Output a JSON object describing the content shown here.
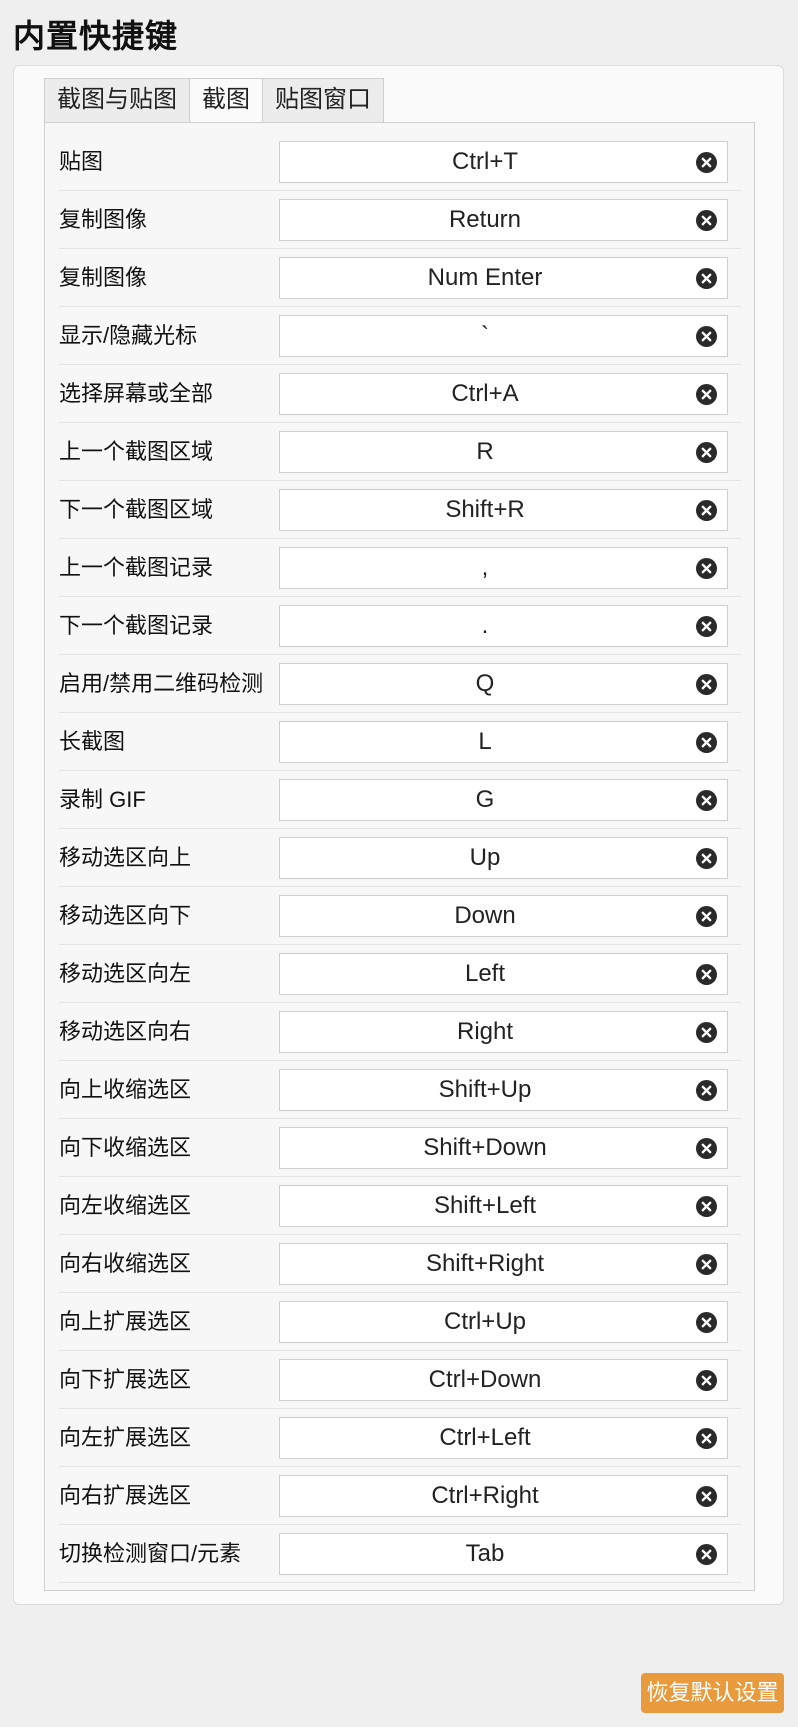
{
  "page": {
    "title": "内置快捷键"
  },
  "tabs": [
    {
      "label": "截图与贴图",
      "active": false
    },
    {
      "label": "截图",
      "active": true
    },
    {
      "label": "贴图窗口",
      "active": false
    }
  ],
  "shortcuts": [
    {
      "label": "贴图",
      "key": "Ctrl+T"
    },
    {
      "label": "复制图像",
      "key": "Return"
    },
    {
      "label": "复制图像",
      "key": "Num Enter"
    },
    {
      "label": "显示/隐藏光标",
      "key": "`"
    },
    {
      "label": "选择屏幕或全部",
      "key": "Ctrl+A"
    },
    {
      "label": "上一个截图区域",
      "key": "R"
    },
    {
      "label": "下一个截图区域",
      "key": "Shift+R"
    },
    {
      "label": "上一个截图记录",
      "key": ","
    },
    {
      "label": "下一个截图记录",
      "key": "."
    },
    {
      "label": "启用/禁用二维码检测",
      "key": "Q"
    },
    {
      "label": "长截图",
      "key": "L"
    },
    {
      "label": "录制 GIF",
      "key": "G"
    },
    {
      "label": "移动选区向上",
      "key": "Up"
    },
    {
      "label": "移动选区向下",
      "key": "Down"
    },
    {
      "label": "移动选区向左",
      "key": "Left"
    },
    {
      "label": "移动选区向右",
      "key": "Right"
    },
    {
      "label": "向上收缩选区",
      "key": "Shift+Up"
    },
    {
      "label": "向下收缩选区",
      "key": "Shift+Down"
    },
    {
      "label": "向左收缩选区",
      "key": "Shift+Left"
    },
    {
      "label": "向右收缩选区",
      "key": "Shift+Right"
    },
    {
      "label": "向上扩展选区",
      "key": "Ctrl+Up"
    },
    {
      "label": "向下扩展选区",
      "key": "Ctrl+Down"
    },
    {
      "label": "向左扩展选区",
      "key": "Ctrl+Left"
    },
    {
      "label": "向右扩展选区",
      "key": "Ctrl+Right"
    },
    {
      "label": "切换检测窗口/元素",
      "key": "Tab"
    }
  ],
  "icons": {
    "clear": "close-circle-icon"
  },
  "footer": {
    "reset_label": "恢复默认设置"
  },
  "colors": {
    "accent": "#e89a3c",
    "clear_icon": "#2a2a2a"
  }
}
